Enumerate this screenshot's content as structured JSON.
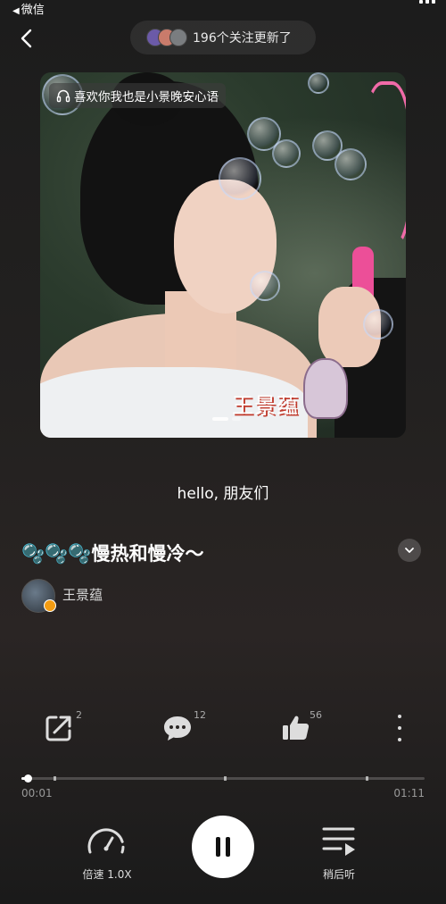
{
  "status_bar": {
    "back_app": "微信"
  },
  "header": {
    "followers_text": "196个关注更新了"
  },
  "cover": {
    "tag_text": "喜欢你我也是小景晚安心语",
    "sticker_text": "王景蕴"
  },
  "lyric": "hello, 朋友们",
  "track": {
    "title": "🫧🫧🫧慢热和慢冷～",
    "author": "王景蕴"
  },
  "actions": {
    "share_count": "2",
    "comment_count": "12",
    "like_count": "56"
  },
  "progress": {
    "current": "00:01",
    "total": "01:11",
    "fraction": 0.014
  },
  "controls": {
    "speed_label": "倍速 1.0X",
    "later_label": "稍后听"
  },
  "colors": {
    "background": "#1c1c1c",
    "accent": "#ffffff",
    "wand": "#ec4f98"
  }
}
